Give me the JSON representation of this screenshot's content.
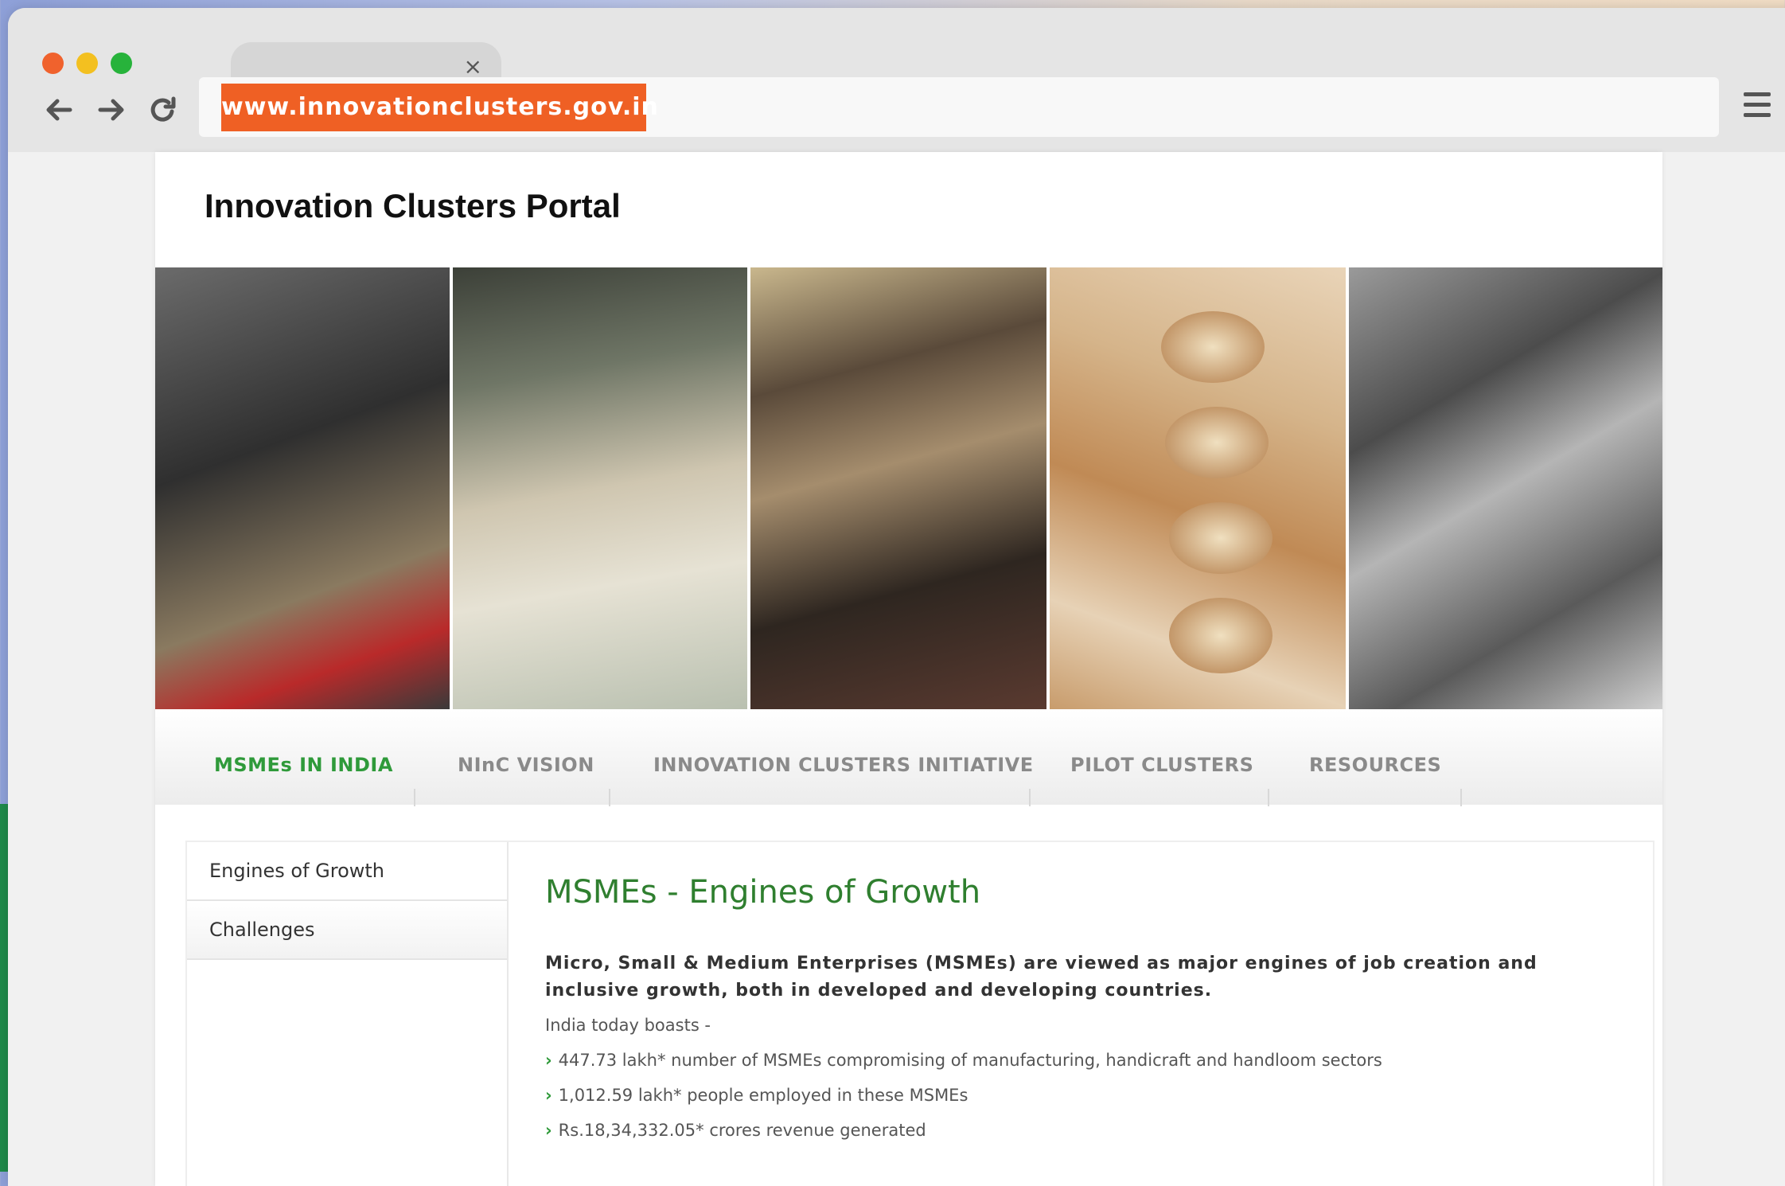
{
  "browser": {
    "url": "www.innovationclusters.gov.in",
    "tab_close": "×"
  },
  "site": {
    "title": "Innovation Clusters Portal"
  },
  "nav": [
    {
      "label": "MSMEs IN INDIA",
      "active": true
    },
    {
      "label": "NInC VISION",
      "active": false
    },
    {
      "label": "INNOVATION CLUSTERS INITIATIVE",
      "active": false
    },
    {
      "label": "PILOT CLUSTERS",
      "active": false
    },
    {
      "label": "RESOURCES",
      "active": false
    }
  ],
  "sidebar": {
    "items": [
      {
        "label": "Engines of Growth"
      },
      {
        "label": "Challenges"
      }
    ]
  },
  "article": {
    "heading": "MSMEs - Engines of Growth",
    "lead": "Micro, Small & Medium Enterprises (MSMEs) are viewed as major engines of job creation and inclusive growth, both in developed and developing countries.",
    "intro": "India today boasts -",
    "bullets": [
      "447.73 lakh* number of MSMEs compromising of manufacturing, handicraft and handloom sectors",
      "1,012.59 lakh* people employed in these MSMEs",
      "Rs.18,34,332.05* crores revenue generated"
    ]
  },
  "colors": {
    "accent_orange": "#ef6024",
    "nav_active_green": "#2f9a3a",
    "heading_green": "#2f7f2f"
  }
}
